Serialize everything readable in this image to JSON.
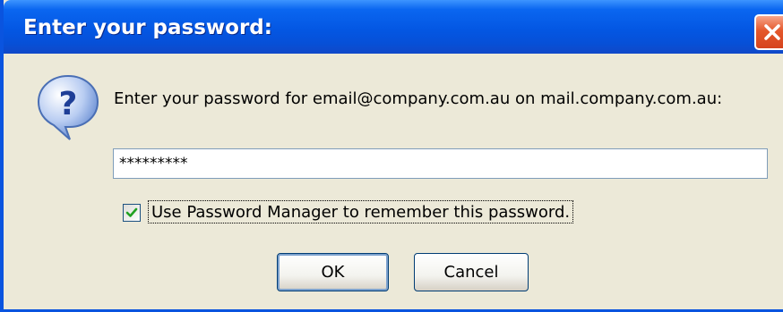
{
  "dialog": {
    "title": "Enter your password:",
    "prompt": "Enter your password for email@company.com.au on mail.company.com.au:",
    "password_value": "*********",
    "remember_label": "Use Password Manager to remember this password.",
    "remember_checked": true,
    "ok_label": "OK",
    "cancel_label": "Cancel"
  },
  "icons": {
    "question": "question-icon",
    "close": "close-icon",
    "check": "checkmark-icon"
  },
  "colors": {
    "titlebar": "#0457e3",
    "dialog_bg": "#ece9d8",
    "close_button": "#e4582c",
    "checkmark": "#21a121"
  }
}
